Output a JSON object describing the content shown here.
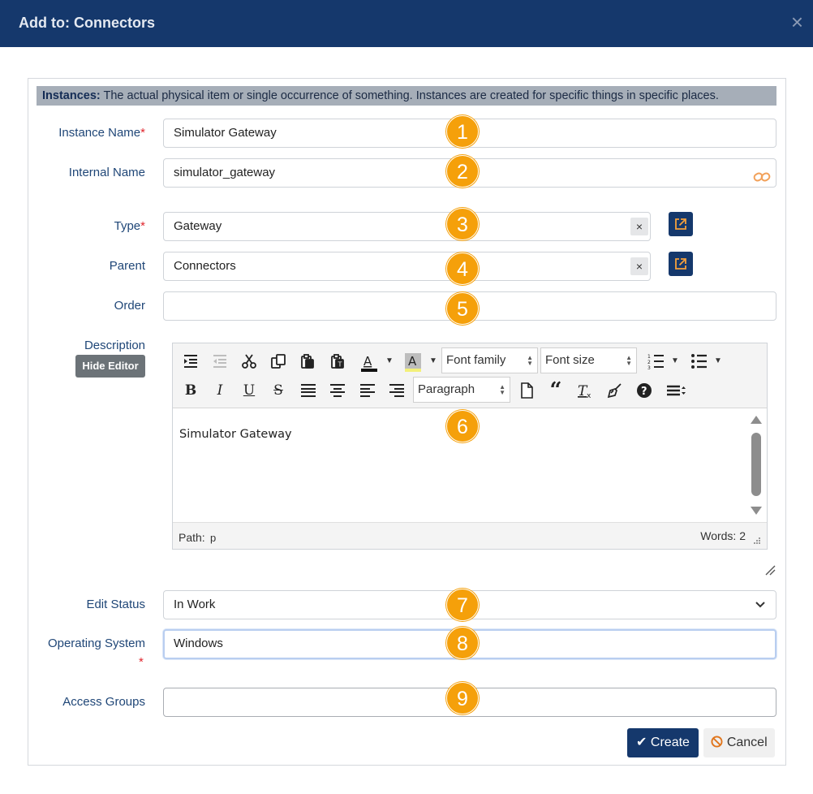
{
  "dialog": {
    "title": "Add to: Connectors",
    "close_symbol": "×"
  },
  "info": {
    "heading": "Instances:",
    "text": " The actual physical item or single occurrence of something. Instances are created for specific things in specific places."
  },
  "labels": {
    "instance_name": "Instance Name",
    "internal_name": "Internal Name",
    "type": "Type",
    "parent": "Parent",
    "order": "Order",
    "description": "Description",
    "edit_status": "Edit Status",
    "operating_system": "Operating System",
    "access_groups": "Access Groups",
    "required_mark": "*"
  },
  "fields": {
    "instance_name": "Simulator Gateway",
    "internal_name": "simulator_gateway",
    "type": "Gateway",
    "parent": "Connectors",
    "order": "",
    "edit_status": "In Work",
    "operating_system": "Windows",
    "access_groups": ""
  },
  "buttons": {
    "hide_editor": "Hide Editor",
    "clear": "×",
    "create": "Create",
    "cancel": "Cancel",
    "create_icon": "✔",
    "cancel_icon": "⃠"
  },
  "editor": {
    "font_family": "Font family",
    "font_size": "Font size",
    "block_format": "Paragraph",
    "content": "Simulator Gateway",
    "path_label": "Path:",
    "path_value": "p",
    "word_count": "Words: 2"
  },
  "badges": [
    "1",
    "2",
    "3",
    "4",
    "5",
    "6",
    "7",
    "8",
    "9"
  ],
  "colors": {
    "header_bg": "#15386c",
    "badge": "#f5a00a",
    "label": "#1f4677",
    "required": "#e0262d",
    "info_bar": "#a6aeb8",
    "cancel_icon": "#e0751c"
  },
  "icons": {
    "link": "link-icon",
    "external": "external-link-icon",
    "dropdown": "chevron-down-icon"
  }
}
